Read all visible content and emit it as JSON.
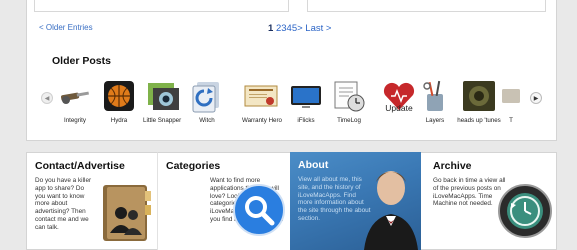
{
  "pagination": {
    "older_entries": "< Older Entries",
    "current": "1",
    "pages": [
      "2",
      "3",
      "4",
      "5"
    ],
    "next": "> Last >"
  },
  "older_posts": {
    "title": "Older Posts",
    "items": [
      {
        "label": "Integrity",
        "icon": "screwdriver-icon"
      },
      {
        "label": "Hydra",
        "icon": "basketball-icon"
      },
      {
        "label": "Little Snapper",
        "icon": "camera-icon"
      },
      {
        "label": "Witch",
        "icon": "window-switch-icon"
      },
      {
        "label": "Warranty Hero",
        "icon": "certificate-icon"
      },
      {
        "label": "iFlicks",
        "icon": "tv-icon"
      },
      {
        "label": "TimeLog",
        "icon": "stopwatch-icon"
      },
      {
        "label": "Update",
        "icon": "heart-update-icon"
      },
      {
        "label": "Layers",
        "icon": "tools-cup-icon"
      },
      {
        "label": "heads up 'tunes",
        "icon": "speaker-icon"
      },
      {
        "label": "T",
        "icon": "partial-icon"
      }
    ]
  },
  "contact": {
    "title": "Contact/Advertise",
    "text": "Do you have a killer app to share? Do you want to know more about advertising? Then contact me and we can talk."
  },
  "categories": {
    "title": "Categories",
    "text": "Want to find more applications that you will love? Look through the categories section of iLoveMacApps to see if you find anything you like."
  },
  "about": {
    "title": "About",
    "text": "View all about me, this site, and the history of iLoveMacApps. Find more information about the site through the about section."
  },
  "archive": {
    "title": "Archive",
    "text": "Go back in time a view all of the previous posts on iLoveMacApps. Time Machine not needed."
  }
}
